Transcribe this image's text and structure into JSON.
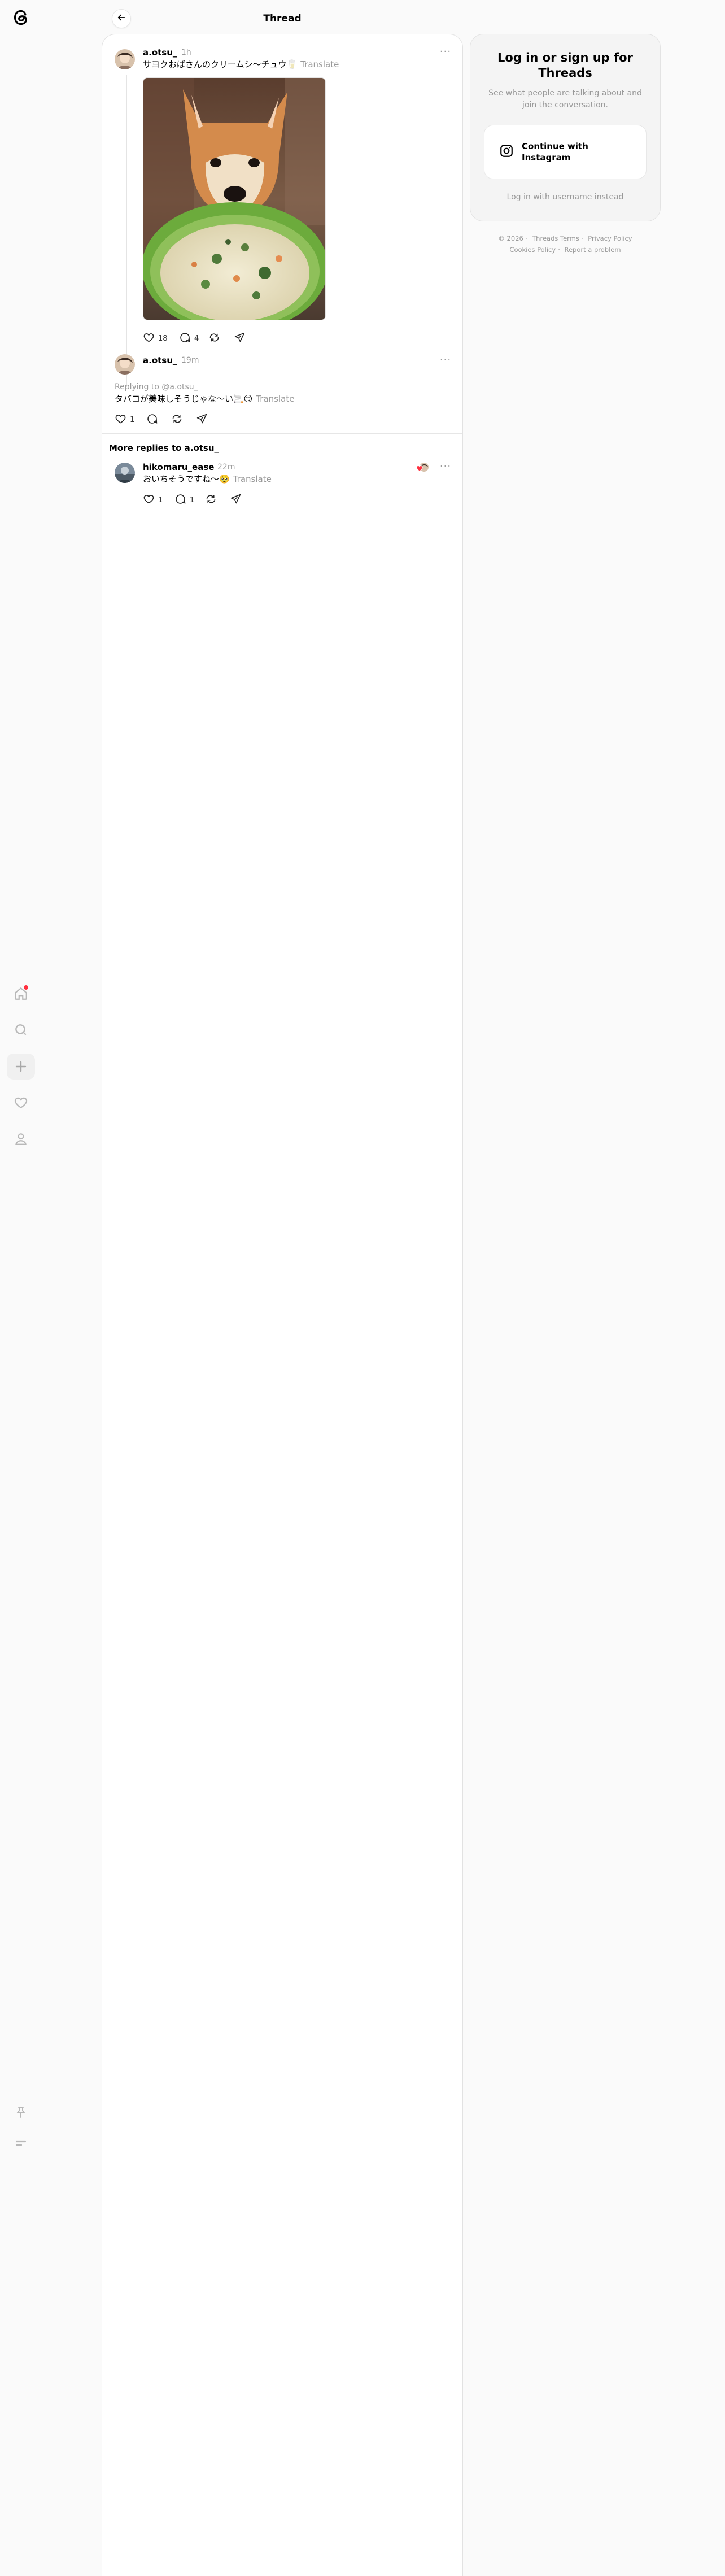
{
  "header": {
    "title": "Thread"
  },
  "post": {
    "username": "a.otsu_",
    "time": "1h",
    "text": "サヨクおばさんのクリームシ〜チュウ🥛",
    "translate": "Translate",
    "image_alt": "Shiba Inu dog behind a green bowl of cream stew",
    "likes": "18",
    "comments": "4"
  },
  "reply": {
    "username": "a.otsu_",
    "time": "19m",
    "replying_to": "Replying to @a.otsu_",
    "text": "タバコが美味しそうじゃな〜い🚬😏",
    "translate": "Translate",
    "likes": "1"
  },
  "more_replies": {
    "heading": "More replies to a.otsu_",
    "username": "hikomaru_ease",
    "time": "22m",
    "text": "おいちそうですね〜🥹",
    "translate": "Translate",
    "likes": "1",
    "comments": "1"
  },
  "login": {
    "title": "Log in or sign up for Threads",
    "subtitle": "See what people are talking about and join the conversation.",
    "button": "Continue with Instagram",
    "username_link": "Log in with username instead"
  },
  "footer": {
    "copyright": "© 2026",
    "terms": "Threads Terms",
    "privacy": "Privacy Policy",
    "cookies": "Cookies Policy",
    "report": "Report a problem"
  },
  "colors": {
    "accent_red": "#ff3040",
    "muted": "#999999",
    "divider": "#e6e6e6"
  },
  "icons": [
    "threads-logo-icon",
    "back-arrow-icon",
    "home-icon",
    "search-icon",
    "plus-icon",
    "heart-icon",
    "profile-icon",
    "pin-icon",
    "menu-icon",
    "more-icon",
    "comment-icon",
    "repost-icon",
    "share-icon",
    "instagram-icon"
  ]
}
